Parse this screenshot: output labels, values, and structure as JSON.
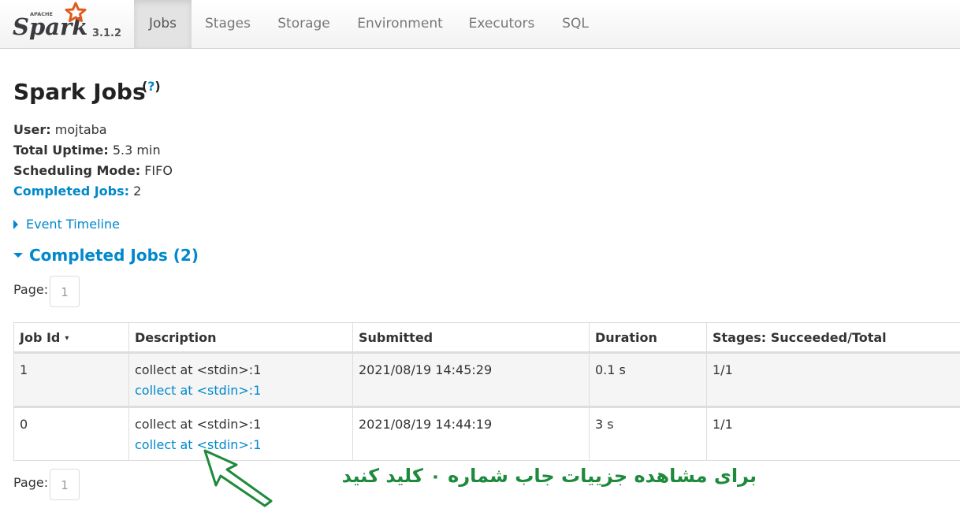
{
  "nav": {
    "brand_wordmark": "Spark",
    "brand_apache": "APACHE",
    "version": "3.1.2",
    "tabs": [
      {
        "label": "Jobs",
        "active": true
      },
      {
        "label": "Stages",
        "active": false
      },
      {
        "label": "Storage",
        "active": false
      },
      {
        "label": "Environment",
        "active": false
      },
      {
        "label": "Executors",
        "active": false
      },
      {
        "label": "SQL",
        "active": false
      }
    ]
  },
  "header": {
    "title": "Spark Jobs",
    "help": "(?)",
    "help_open": "(",
    "help_q": "?",
    "help_close": ")"
  },
  "summary": {
    "user_label": "User:",
    "user_value": "mojtaba",
    "uptime_label": "Total Uptime:",
    "uptime_value": "5.3 min",
    "scheduling_label": "Scheduling Mode:",
    "scheduling_value": "FIFO",
    "completed_label": "Completed Jobs:",
    "completed_value": "2"
  },
  "event_timeline": "Event Timeline",
  "completed_section": "Completed Jobs (2)",
  "pager": {
    "label": "Page:",
    "page": "1"
  },
  "table": {
    "headers": [
      "Job Id",
      "Description",
      "Submitted",
      "Duration",
      "Stages: Succeeded/Total"
    ],
    "sort_indicator": "▾",
    "rows": [
      {
        "job_id": "1",
        "description": "collect at <stdin>:1",
        "description_link": "collect at <stdin>:1",
        "submitted": "2021/08/19 14:45:29",
        "duration": "0.1 s",
        "stages": "1/1"
      },
      {
        "job_id": "0",
        "description": "collect at <stdin>:1",
        "description_link": "collect at <stdin>:1",
        "submitted": "2021/08/19 14:44:19",
        "duration": "3 s",
        "stages": "1/1"
      }
    ]
  },
  "annotation": {
    "text": "برای مشاهده جزییات جاب شماره ۰ کلید کنید",
    "color": "#1e8a3c"
  },
  "colors": {
    "link": "#0088cc",
    "brand_star": "#e25a1c"
  }
}
